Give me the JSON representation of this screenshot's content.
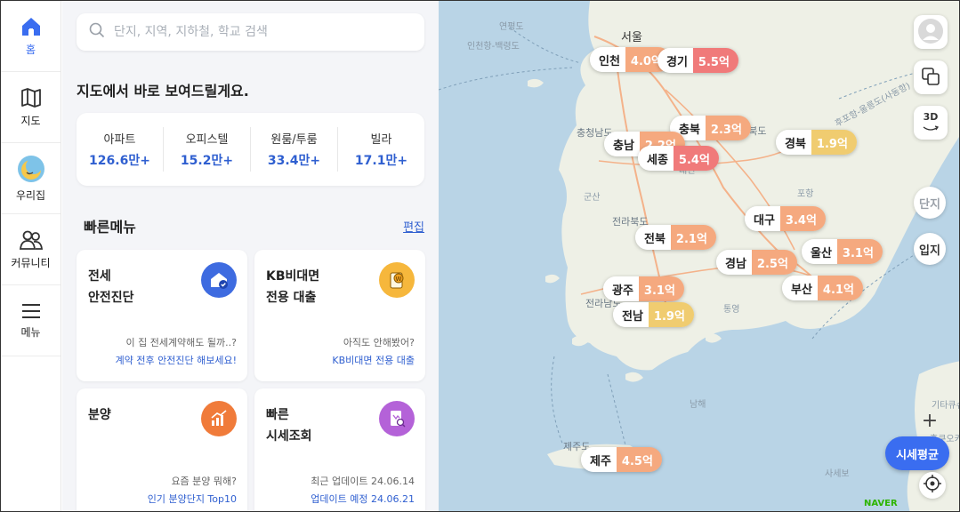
{
  "nav": {
    "items": [
      {
        "label": "홈",
        "icon": "home-icon"
      },
      {
        "label": "지도",
        "icon": "map-icon"
      },
      {
        "label": "우리집",
        "icon": "moon-house-icon"
      },
      {
        "label": "커뮤니티",
        "icon": "people-icon"
      },
      {
        "label": "메뉴",
        "icon": "menu-icon"
      }
    ]
  },
  "search": {
    "placeholder": "단지, 지역, 지하철, 학교 검색"
  },
  "heading": "지도에서 바로 보여드릴게요.",
  "stats": [
    {
      "label": "아파트",
      "value": "126.6만+"
    },
    {
      "label": "오피스텔",
      "value": "15.2만+"
    },
    {
      "label": "원룸/투룸",
      "value": "33.4만+"
    },
    {
      "label": "빌라",
      "value": "17.1만+"
    }
  ],
  "quick_menu": {
    "title": "빠른메뉴",
    "edit": "편집",
    "cards": [
      {
        "title1": "전세",
        "title2": "안전진단",
        "question": "이 집 전세계약해도 될까..?",
        "link": "계약 전후 안전진단 해보세요!",
        "icon": "shield-house-icon",
        "color": "#3e6be0"
      },
      {
        "title1": "KB비대면",
        "title2": "전용 대출",
        "question": "아직도 안해봤어?",
        "link": "KB비대면 전용 대출",
        "icon": "coin-card-icon",
        "color": "#f6b73c"
      },
      {
        "title1": "분양",
        "title2": "",
        "question": "요즘 분양 뭐해?",
        "link": "인기 분양단지 Top10",
        "icon": "chart-up-icon",
        "color": "#f07b3a"
      },
      {
        "title1": "빠른",
        "title2": "시세조회",
        "question": "최근 업데이트 24.06.14",
        "link": "업데이트 예정 24.06.21",
        "icon": "document-search-icon",
        "color": "#b462d8"
      }
    ]
  },
  "map": {
    "markers": [
      {
        "name": "인천",
        "value": "4.0억",
        "level": "orange"
      },
      {
        "name": "경기",
        "value": "5.5억",
        "level": "red"
      },
      {
        "name": "충북",
        "value": "2.3억",
        "level": "orange"
      },
      {
        "name": "경북",
        "value": "1.9억",
        "level": "yellow"
      },
      {
        "name": "충남",
        "value": "2.2억",
        "level": "orange"
      },
      {
        "name": "세종",
        "value": "5.4억",
        "level": "red"
      },
      {
        "name": "대구",
        "value": "3.4억",
        "level": "orange"
      },
      {
        "name": "전북",
        "value": "2.1억",
        "level": "orange"
      },
      {
        "name": "울산",
        "value": "3.1억",
        "level": "orange"
      },
      {
        "name": "경남",
        "value": "2.5억",
        "level": "orange"
      },
      {
        "name": "광주",
        "value": "3.1억",
        "level": "orange"
      },
      {
        "name": "부산",
        "value": "4.1억",
        "level": "orange"
      },
      {
        "name": "전남",
        "value": "1.9억",
        "level": "yellow"
      },
      {
        "name": "제주",
        "value": "4.5억",
        "level": "orange"
      }
    ],
    "labels": [
      "서울",
      "연평도",
      "인천항-백령도",
      "충청남도",
      "경상북도",
      "포항",
      "군산",
      "전라북도",
      "전라남도",
      "통영",
      "남해",
      "제주도",
      "사세보",
      "기타큐슈",
      "후쿠오카",
      "연평도",
      "인천항-제주도",
      "목포항-제주",
      "녹동신항-제주항",
      "대전",
      "후포항-울릉도(사동항)",
      "NAVER"
    ],
    "buttons": {
      "btn_3d": "3D",
      "danji": "단지",
      "ipji": "입지",
      "price": "시세평균",
      "zoom_in": "+"
    }
  }
}
